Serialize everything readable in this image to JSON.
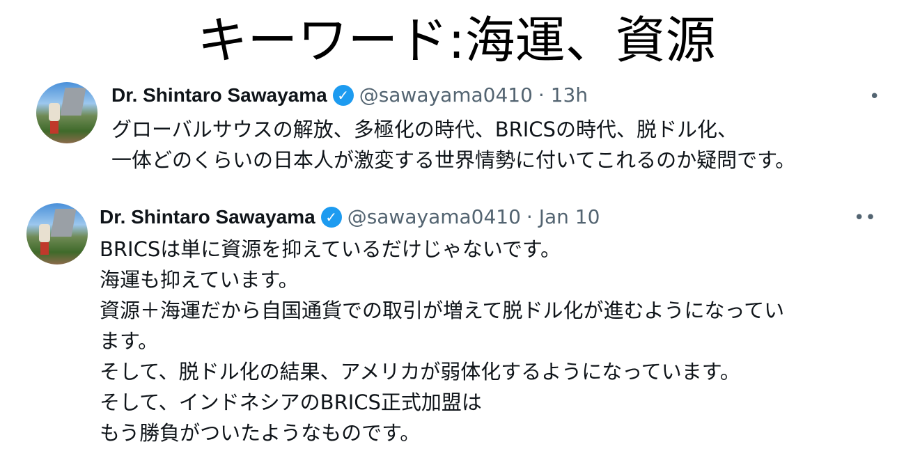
{
  "slide_title": "キーワード:海運、資源",
  "tweets": [
    {
      "name": "Dr. Shintaro Sawayama",
      "handle": "@sawayama0410",
      "time": "· 13h",
      "more": "•",
      "lines": [
        "グローバルサウスの解放、多極化の時代、BRICSの時代、脱ドル化、",
        "一体どのくらいの日本人が激変する世界情勢に付いてこれるのか疑問です。"
      ]
    },
    {
      "name": "Dr. Shintaro Sawayama",
      "handle": "@sawayama0410",
      "time": "· Jan 10",
      "more": "••",
      "lines": [
        "BRICSは単に資源を抑えているだけじゃないです。",
        "海運も抑えています。",
        "資源＋海運だから自国通貨での取引が増えて脱ドル化が進むようになってい",
        "ます。",
        "そして、脱ドル化の結果、アメリカが弱体化するようになっています。",
        "そして、インドネシアのBRICS正式加盟は",
        "もう勝負がついたようなものです。"
      ]
    }
  ],
  "colors": {
    "verified": "#1d9bf0",
    "secondary": "#536471"
  }
}
